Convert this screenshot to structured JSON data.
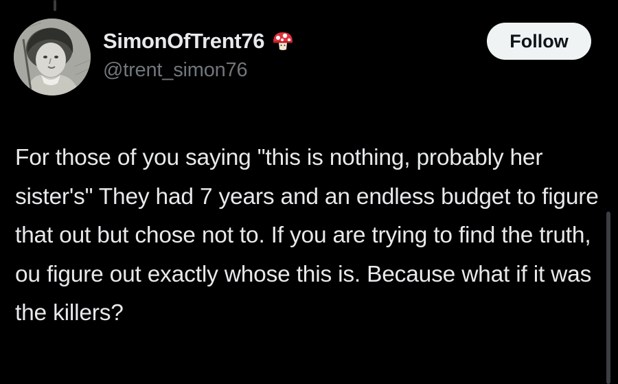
{
  "author": {
    "display_name": "SimonOfTrent76",
    "handle": "@trent_simon76",
    "badge_icon": "mushroom-icon",
    "avatar": "engraved-child-portrait"
  },
  "actions": {
    "follow_label": "Follow"
  },
  "post": {
    "text": "For those of you saying \"this is nothing, probably her sister's\" They had 7 years and an endless budget to figure that out but chose not to.  If you are trying to find the truth, ou figure out exactly whose this is.  Because what if it was the killers?"
  },
  "colors": {
    "background": "#000000",
    "text_primary": "#e7e9ea",
    "text_secondary": "#71767b",
    "follow_bg": "#eff3f4",
    "mushroom_red": "#e0303a"
  }
}
